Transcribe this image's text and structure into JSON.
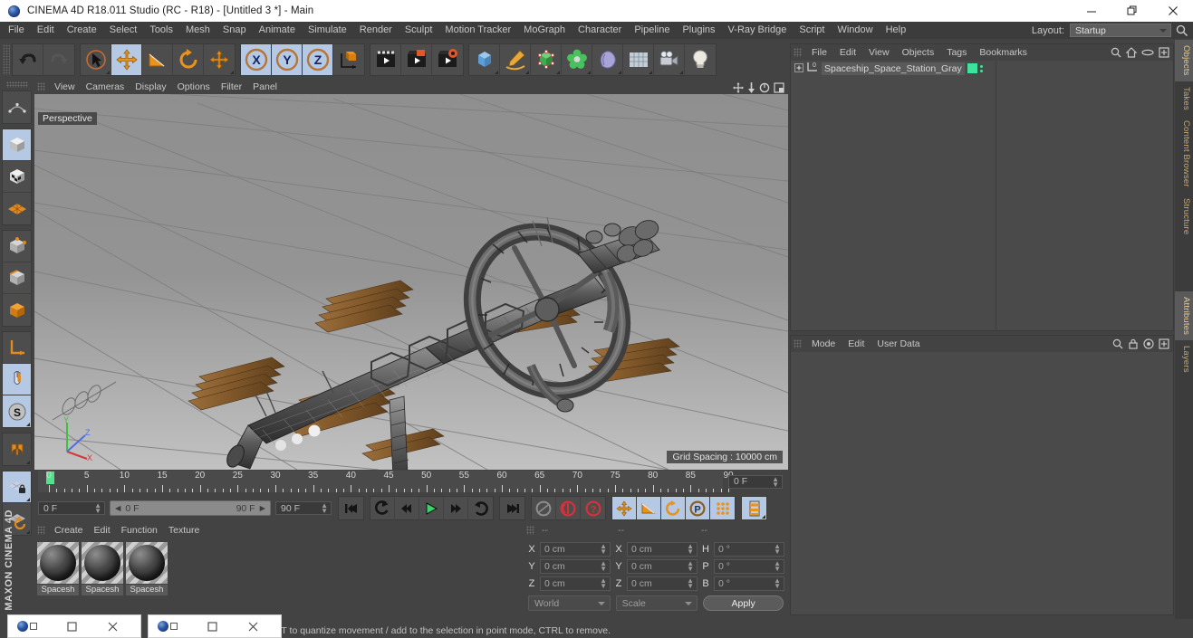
{
  "window": {
    "title": "CINEMA 4D R18.011 Studio (RC - R18) - [Untitled 3 *] - Main",
    "app_icon": "cinema4d-logo-icon",
    "minimize": "minimize-icon",
    "maximize": "restore-icon",
    "close": "close-icon"
  },
  "menubar": {
    "items": [
      "File",
      "Edit",
      "Create",
      "Select",
      "Tools",
      "Mesh",
      "Snap",
      "Animate",
      "Simulate",
      "Render",
      "Sculpt",
      "Motion Tracker",
      "MoGraph",
      "Character",
      "Pipeline",
      "Plugins",
      "V-Ray Bridge",
      "Script",
      "Window",
      "Help"
    ],
    "layout_label": "Layout:",
    "layout_value": "Startup",
    "search_icon": "search-icon"
  },
  "toolbar": {
    "groups": [
      {
        "buttons": [
          {
            "name": "undo-icon",
            "state": "normal"
          },
          {
            "name": "redo-icon",
            "state": "disabled"
          }
        ]
      },
      {
        "buttons": [
          {
            "name": "live-selection-icon",
            "state": "normal"
          },
          {
            "name": "move-tool-icon",
            "state": "active"
          },
          {
            "name": "scale-tool-icon",
            "state": "normal"
          },
          {
            "name": "rotate-tool-icon",
            "state": "normal"
          },
          {
            "name": "move-alt-icon",
            "state": "normal"
          }
        ]
      },
      {
        "buttons": [
          {
            "name": "x-axis-lock-icon",
            "state": "active"
          },
          {
            "name": "y-axis-lock-icon",
            "state": "active"
          },
          {
            "name": "z-axis-lock-icon",
            "state": "active"
          },
          {
            "name": "world-object-axis-icon",
            "state": "normal"
          }
        ]
      },
      {
        "buttons": [
          {
            "name": "render-view-icon",
            "state": "normal"
          },
          {
            "name": "render-region-icon",
            "state": "normal"
          },
          {
            "name": "render-settings-icon",
            "state": "normal"
          }
        ]
      },
      {
        "buttons": [
          {
            "name": "cube-primitive-icon",
            "state": "normal"
          },
          {
            "name": "spline-pen-icon",
            "state": "normal"
          },
          {
            "name": "nurbs-generator-icon",
            "state": "normal"
          },
          {
            "name": "array-modeling-icon",
            "state": "normal"
          },
          {
            "name": "deformer-icon",
            "state": "normal"
          },
          {
            "name": "environment-floor-icon",
            "state": "normal"
          },
          {
            "name": "camera-icon",
            "state": "normal"
          },
          {
            "name": "light-icon",
            "state": "normal"
          }
        ]
      }
    ]
  },
  "leftbar": {
    "buttons": [
      {
        "name": "make-editable-icon",
        "state": "normal"
      },
      {
        "name": "model-mode-icon",
        "state": "active"
      },
      {
        "name": "texture-mode-icon",
        "state": "normal"
      },
      {
        "name": "workplane-mode-icon",
        "state": "normal"
      },
      {
        "name": "point-mode-icon",
        "state": "normal"
      },
      {
        "name": "edge-mode-icon",
        "state": "normal"
      },
      {
        "name": "polygon-mode-icon",
        "state": "normal"
      },
      {
        "name": "axis-mode-icon",
        "state": "normal"
      },
      {
        "name": "enable-axis-icon",
        "state": "active"
      },
      {
        "name": "soft-selection-icon",
        "state": "active"
      },
      {
        "name": "snap-magnet-icon",
        "state": "normal"
      },
      {
        "name": "lock-workplane-icon",
        "state": "active"
      },
      {
        "name": "planar-workplane-icon",
        "state": "normal"
      }
    ],
    "brand_top": "MAXON",
    "brand_bottom": "CINEMA 4D"
  },
  "viewport": {
    "menus": [
      "View",
      "Cameras",
      "Display",
      "Options",
      "Filter",
      "Panel"
    ],
    "corner_icons": [
      "pan-view-icon",
      "dolly-view-icon",
      "rotate-view-icon",
      "maximize-view-icon"
    ],
    "label": "Perspective",
    "grid_spacing": "Grid Spacing : 10000 cm",
    "axis_gizmo": {
      "x": "X",
      "y": "Y",
      "z": "Z"
    },
    "scene_object": "spaceship-space-station-model"
  },
  "timeline": {
    "ticks": [
      "0",
      "5",
      "10",
      "15",
      "20",
      "25",
      "30",
      "35",
      "40",
      "45",
      "50",
      "55",
      "60",
      "65",
      "70",
      "75",
      "80",
      "85",
      "90"
    ],
    "current_frame_field": "0 F",
    "playhead_frame": "0"
  },
  "playback": {
    "start_field": "0 F",
    "range_start": "0 F",
    "range_end": "90 F",
    "end_field": "90 F",
    "buttons": [
      {
        "name": "go-to-start-icon",
        "state": "normal"
      },
      {
        "name": "previous-keyframe-icon",
        "state": "normal"
      },
      {
        "name": "step-back-icon",
        "state": "normal"
      },
      {
        "name": "play-icon",
        "state": "normal"
      },
      {
        "name": "step-forward-icon",
        "state": "normal"
      },
      {
        "name": "next-keyframe-icon",
        "state": "normal"
      },
      {
        "name": "go-to-end-icon",
        "state": "normal"
      },
      {
        "name": "autokey-toggle-icon",
        "state": "disabled"
      },
      {
        "name": "record-active-objects-icon",
        "state": "normal"
      },
      {
        "name": "record-question-icon",
        "state": "normal"
      },
      {
        "name": "position-key-icon",
        "state": "active"
      },
      {
        "name": "scale-key-icon",
        "state": "active"
      },
      {
        "name": "rotation-key-icon",
        "state": "active"
      },
      {
        "name": "parameter-key-icon",
        "state": "active"
      },
      {
        "name": "point-level-animation-icon",
        "state": "normal"
      },
      {
        "name": "timeline-layout-icon",
        "state": "active"
      }
    ]
  },
  "materials": {
    "menus": [
      "Create",
      "Edit",
      "Function",
      "Texture"
    ],
    "items": [
      {
        "label": "Spacesh",
        "icon": "material-sphere-icon"
      },
      {
        "label": "Spacesh",
        "icon": "material-sphere-icon"
      },
      {
        "label": "Spacesh",
        "icon": "material-sphere-icon"
      }
    ]
  },
  "coordinates": {
    "headers": [
      "--",
      "--",
      "--"
    ],
    "rows": [
      {
        "pos_axis": "X",
        "pos_value": "0 cm",
        "size_axis": "X",
        "size_value": "0 cm",
        "rot_axis": "H",
        "rot_value": "0 °"
      },
      {
        "pos_axis": "Y",
        "pos_value": "0 cm",
        "size_axis": "Y",
        "size_value": "0 cm",
        "rot_axis": "P",
        "rot_value": "0 °"
      },
      {
        "pos_axis": "Z",
        "pos_value": "0 cm",
        "size_axis": "Z",
        "size_value": "0 cm",
        "rot_axis": "B",
        "rot_value": "0 °"
      }
    ],
    "coord_system": "World",
    "transform_mode": "Scale",
    "apply_label": "Apply"
  },
  "object_manager": {
    "menus": [
      "File",
      "Edit",
      "View",
      "Objects",
      "Tags",
      "Bookmarks"
    ],
    "header_icons": [
      "search-icon",
      "home-icon",
      "link-icon",
      "expand-icon"
    ],
    "items": [
      {
        "name": "Spaceship_Space_Station_Gray",
        "layer_badge": "0",
        "tag_color": "#3ee39c"
      }
    ]
  },
  "attributes": {
    "menus": [
      "Mode",
      "Edit",
      "User Data"
    ],
    "header_icons": [
      "search-icon",
      "lock-icon",
      "target-icon",
      "expand-icon"
    ]
  },
  "right_tabs": [
    {
      "label": "Objects",
      "selected": true
    },
    {
      "label": "Takes",
      "selected": false
    },
    {
      "label": "Content Browser",
      "selected": false
    },
    {
      "label": "Structure",
      "selected": false
    },
    {
      "label": "Attributes",
      "selected": true
    },
    {
      "label": "Layers",
      "selected": false
    }
  ],
  "statusbar": {
    "message": "FT to quantize movement / add to the selection in point mode, CTRL to remove."
  },
  "taskbar_windows": [
    {
      "icon": "cinema4d-logo-icon",
      "restore": "restore-icon",
      "close": "close-icon"
    },
    {
      "icon": "cinema4d-logo-icon",
      "restore": "restore-icon",
      "close": "close-icon"
    }
  ],
  "colors": {
    "chrome": "#434343",
    "panel": "#4a4a4a",
    "accent_orange": "#e08a22",
    "accent_blue": "#b6c9e4",
    "green_tag": "#3ee39c",
    "solar_panel": "#8a6134"
  }
}
